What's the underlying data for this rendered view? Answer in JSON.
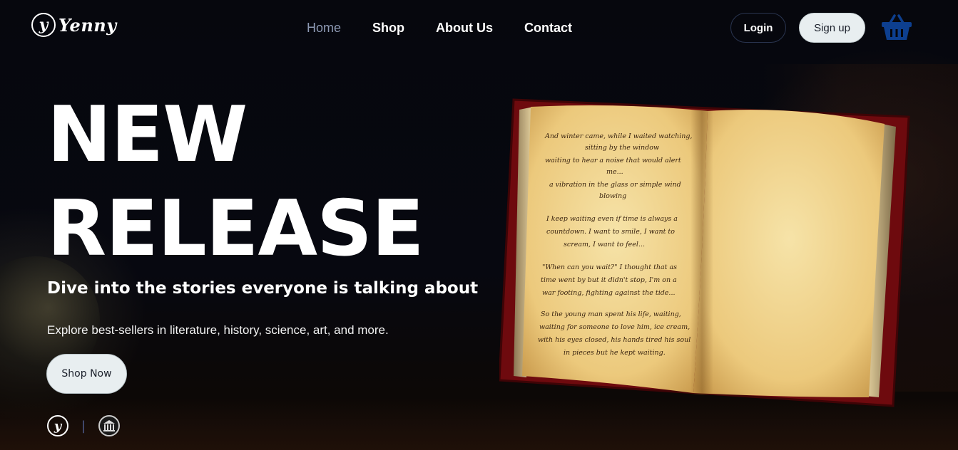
{
  "brand": {
    "logo_letter": "y",
    "name": "Yenny"
  },
  "nav": {
    "items": [
      {
        "label": "Home",
        "active": true
      },
      {
        "label": "Shop",
        "active": false
      },
      {
        "label": "About Us",
        "active": false
      },
      {
        "label": "Contact",
        "active": false
      }
    ]
  },
  "auth": {
    "login_label": "Login",
    "signup_label": "Sign up"
  },
  "cart": {
    "icon": "basket-icon",
    "color": "#0d3f8f"
  },
  "hero": {
    "title_line1": "NEW",
    "title_line2": "RELEASE",
    "subtitle": "Dive into the stories everyone is talking about",
    "description": "Explore best-sellers in literature, history, science, art, and more.",
    "cta_label": "Shop Now"
  },
  "footer": {
    "icons": [
      "yenny-logo-icon",
      "museum-icon"
    ],
    "separator": "|",
    "mini_logo_letter": "y"
  },
  "book": {
    "page_lines": [
      "And winter came, while I waited watching,",
      "sitting by the window",
      "waiting to hear a noise that would alert",
      "me...",
      "a vibration in the glass or simple wind",
      "blowing",
      "I keep waiting even if time is always a",
      "countdown. I want to smile, I want to",
      "scream, I want to feel...",
      "\"When can you wait?\" I thought that as",
      "time went by but it didn't stop, I'm on a",
      "war footing, fighting against the tide...",
      "So the young man spent his life, waiting,",
      "waiting for someone to love him, ice cream,",
      "with his eyes closed, his hands tired his soul",
      "in pieces but he kept waiting."
    ]
  },
  "colors": {
    "nav_active": "#8e9ab4",
    "button_light": "#e8eef0",
    "cart_blue": "#0d3f8f",
    "book_cover": "#7a0c10",
    "page": "#f0d596"
  }
}
